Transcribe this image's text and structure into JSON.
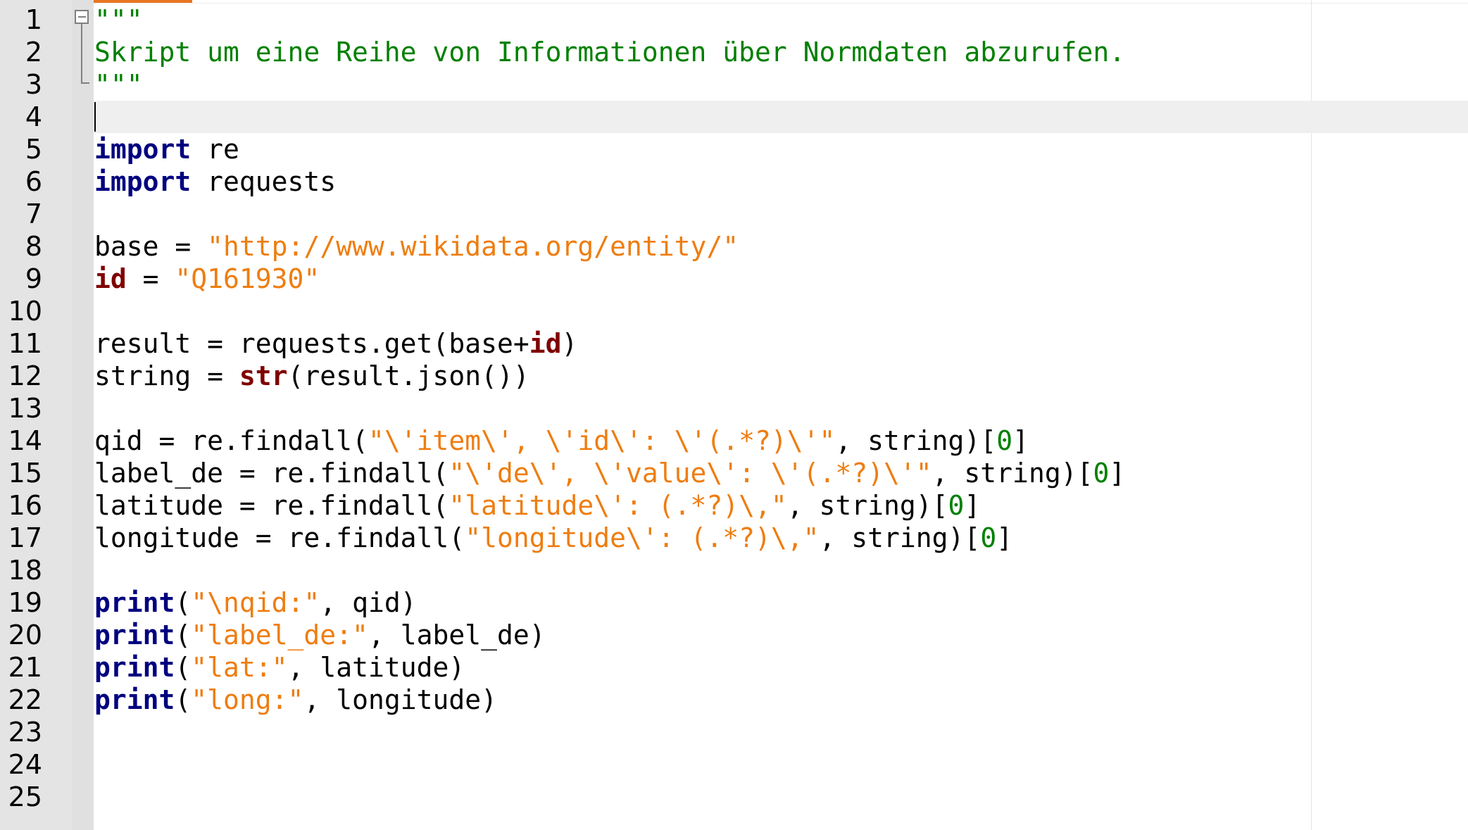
{
  "editor": {
    "language": "python",
    "current_line": 4,
    "line_numbers": [
      "1",
      "2",
      "3",
      "4",
      "5",
      "6",
      "7",
      "8",
      "9",
      "10",
      "11",
      "12",
      "13",
      "14",
      "15",
      "16",
      "17",
      "18",
      "19",
      "20",
      "21",
      "22",
      "23",
      "24",
      "25"
    ],
    "colors": {
      "keyword": "#00007f",
      "builtin": "#7f0000",
      "string": "#ee7d10",
      "number": "#008000",
      "docstring": "#008000",
      "gutter": "#e4e4e4",
      "current_line": "#efefef",
      "tab_accent": "#e8761f"
    },
    "icons": {
      "fold_marker": "minus-box-icon"
    },
    "lines": [
      {
        "tokens": [
          {
            "t": "doc",
            "v": "\"\"\""
          }
        ]
      },
      {
        "tokens": [
          {
            "t": "doc",
            "v": "Skript um eine Reihe von Informationen über Normdaten abzurufen."
          }
        ]
      },
      {
        "tokens": [
          {
            "t": "doc",
            "v": "\"\"\""
          }
        ]
      },
      {
        "tokens": []
      },
      {
        "tokens": [
          {
            "t": "kw",
            "v": "import"
          },
          {
            "t": "plain",
            "v": " re"
          }
        ]
      },
      {
        "tokens": [
          {
            "t": "kw",
            "v": "import"
          },
          {
            "t": "plain",
            "v": " requests"
          }
        ]
      },
      {
        "tokens": []
      },
      {
        "tokens": [
          {
            "t": "plain",
            "v": "base = "
          },
          {
            "t": "str",
            "v": "\"http://www.wikidata.org/entity/\""
          }
        ]
      },
      {
        "tokens": [
          {
            "t": "builtin",
            "v": "id"
          },
          {
            "t": "plain",
            "v": " = "
          },
          {
            "t": "str",
            "v": "\"Q161930\""
          }
        ]
      },
      {
        "tokens": []
      },
      {
        "tokens": [
          {
            "t": "plain",
            "v": "result = requests.get(base+"
          },
          {
            "t": "builtin",
            "v": "id"
          },
          {
            "t": "plain",
            "v": ")"
          }
        ]
      },
      {
        "tokens": [
          {
            "t": "plain",
            "v": "string = "
          },
          {
            "t": "builtin",
            "v": "str"
          },
          {
            "t": "plain",
            "v": "(result.json())"
          }
        ]
      },
      {
        "tokens": []
      },
      {
        "tokens": [
          {
            "t": "plain",
            "v": "qid = re.findall("
          },
          {
            "t": "str",
            "v": "\"\\'item\\', \\'id\\': \\'(.*?)\\'\""
          },
          {
            "t": "plain",
            "v": ", string)["
          },
          {
            "t": "num",
            "v": "0"
          },
          {
            "t": "plain",
            "v": "]"
          }
        ]
      },
      {
        "tokens": [
          {
            "t": "plain",
            "v": "label_de = re.findall("
          },
          {
            "t": "str",
            "v": "\"\\'de\\', \\'value\\': \\'(.*?)\\'\""
          },
          {
            "t": "plain",
            "v": ", string)["
          },
          {
            "t": "num",
            "v": "0"
          },
          {
            "t": "plain",
            "v": "]"
          }
        ]
      },
      {
        "tokens": [
          {
            "t": "plain",
            "v": "latitude = re.findall("
          },
          {
            "t": "str",
            "v": "\"latitude\\': (.*?)\\,\""
          },
          {
            "t": "plain",
            "v": ", string)["
          },
          {
            "t": "num",
            "v": "0"
          },
          {
            "t": "plain",
            "v": "]"
          }
        ]
      },
      {
        "tokens": [
          {
            "t": "plain",
            "v": "longitude = re.findall("
          },
          {
            "t": "str",
            "v": "\"longitude\\': (.*?)\\,\""
          },
          {
            "t": "plain",
            "v": ", string)["
          },
          {
            "t": "num",
            "v": "0"
          },
          {
            "t": "plain",
            "v": "]"
          }
        ]
      },
      {
        "tokens": []
      },
      {
        "tokens": [
          {
            "t": "kw",
            "v": "print"
          },
          {
            "t": "plain",
            "v": "("
          },
          {
            "t": "str",
            "v": "\"\\nqid:\""
          },
          {
            "t": "plain",
            "v": ", qid)"
          }
        ]
      },
      {
        "tokens": [
          {
            "t": "kw",
            "v": "print"
          },
          {
            "t": "plain",
            "v": "("
          },
          {
            "t": "str",
            "v": "\"label_de:\""
          },
          {
            "t": "plain",
            "v": ", label_de)"
          }
        ]
      },
      {
        "tokens": [
          {
            "t": "kw",
            "v": "print"
          },
          {
            "t": "plain",
            "v": "("
          },
          {
            "t": "str",
            "v": "\"lat:\""
          },
          {
            "t": "plain",
            "v": ", latitude)"
          }
        ]
      },
      {
        "tokens": [
          {
            "t": "kw",
            "v": "print"
          },
          {
            "t": "plain",
            "v": "("
          },
          {
            "t": "str",
            "v": "\"long:\""
          },
          {
            "t": "plain",
            "v": ", longitude)"
          }
        ]
      },
      {
        "tokens": []
      },
      {
        "tokens": []
      },
      {
        "tokens": []
      }
    ]
  }
}
